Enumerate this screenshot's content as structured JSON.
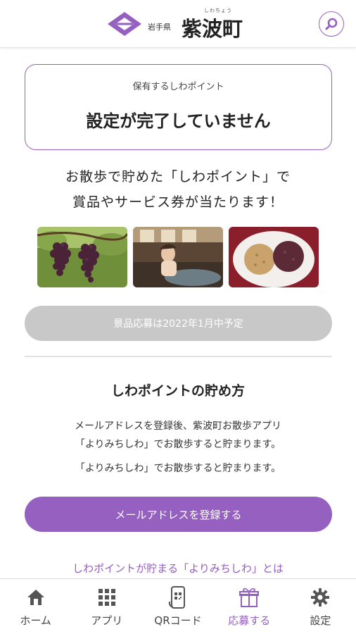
{
  "header": {
    "prefecture": "岩手県",
    "town_ruby": "しわちょう",
    "town_name": "紫波町",
    "search_icon": "search-icon"
  },
  "points_card": {
    "label": "保有するしわポイント",
    "status": "設定が完了していません"
  },
  "intro": {
    "line1": "お散歩で貯めた「しわポイント」で",
    "line2": "賞品やサービス券が当たります！"
  },
  "photos": [
    "grapes-photo",
    "onsen-photo",
    "manju-photo"
  ],
  "prize_button": {
    "label": "景品応募は2022年1月中予定"
  },
  "how_to": {
    "title": "しわポイントの貯め方",
    "line1": "メールアドレスを登録後、紫波町お散歩アプリ",
    "line2": "「よりみちしわ」でお散歩すると貯まります。",
    "line3": "「よりみちしわ」でお散歩すると貯まります。"
  },
  "register_button": {
    "label": "メールアドレスを登録する"
  },
  "yorimichi_link": {
    "label": "しわポイントが貯まる「よりみちしわ」とは"
  },
  "tabbar": {
    "items": [
      {
        "label": "ホーム",
        "icon": "home-icon",
        "active": false
      },
      {
        "label": "アプリ",
        "icon": "apps-grid-icon",
        "active": false
      },
      {
        "label": "QRコード",
        "icon": "qr-code-icon",
        "active": false
      },
      {
        "label": "応募する",
        "icon": "gift-icon",
        "active": true
      },
      {
        "label": "設定",
        "icon": "gear-icon",
        "active": false
      }
    ]
  },
  "colors": {
    "accent": "#9560c0",
    "disabled": "#c8c8c8"
  }
}
